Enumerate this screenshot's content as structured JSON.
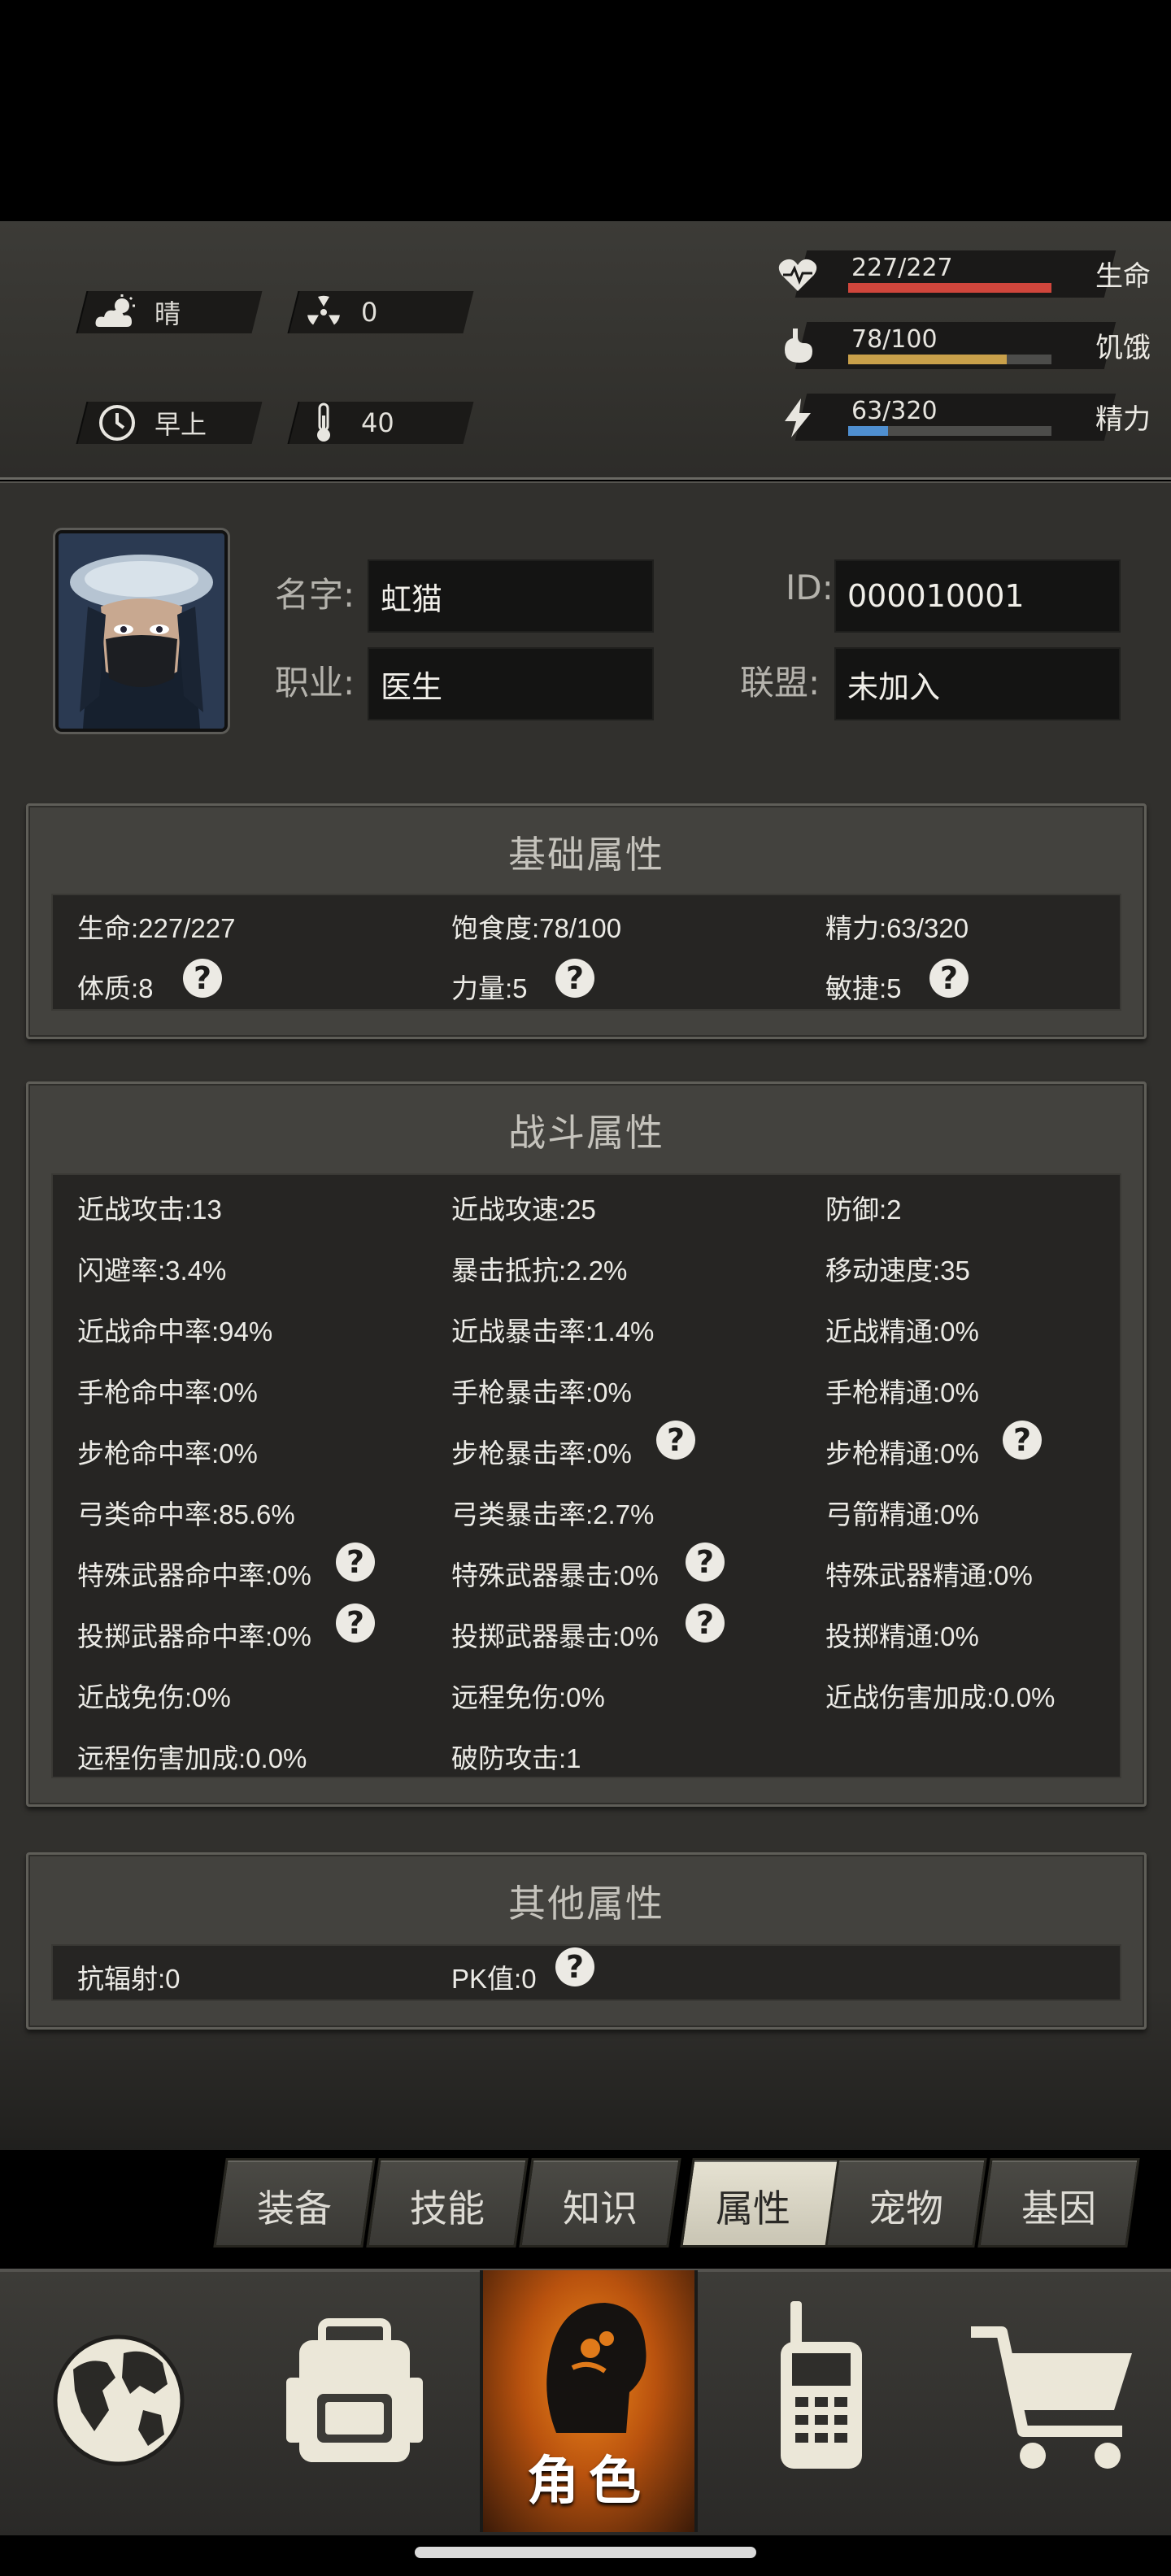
{
  "status": {
    "weather": "晴",
    "radiation": "0",
    "time_of_day": "早上",
    "temperature": "40",
    "hp": {
      "value": "227/227",
      "label": "生命",
      "fraction": 1.0,
      "color": "#d0463c"
    },
    "hunger": {
      "value": "78/100",
      "label": "饥饿",
      "fraction": 0.78,
      "color": "#c9a04a"
    },
    "energy": {
      "value": "63/320",
      "label": "精力",
      "fraction": 0.197,
      "color": "#4f8fd0"
    }
  },
  "profile": {
    "name_label": "名字:",
    "name": "虹猫",
    "job_label": "职业:",
    "job": "医生",
    "id_label": "ID:",
    "id": "000010001",
    "alliance_label": "联盟:",
    "alliance": "未加入"
  },
  "basic": {
    "title": "基础属性",
    "stats": [
      "生命:227/227",
      "饱食度:78/100",
      "精力:63/320",
      "体质:8",
      "力量:5",
      "敏捷:5"
    ]
  },
  "combat": {
    "title": "战斗属性",
    "stats": [
      "近战攻击:13",
      "近战攻速:25",
      "防御:2",
      "闪避率:3.4%",
      "暴击抵抗:2.2%",
      "移动速度:35",
      "近战命中率:94%",
      "近战暴击率:1.4%",
      "近战精通:0%",
      "手枪命中率:0%",
      "手枪暴击率:0%",
      "手枪精通:0%",
      "步枪命中率:0%",
      "步枪暴击率:0%",
      "步枪精通:0%",
      "弓类命中率:85.6%",
      "弓类暴击率:2.7%",
      "弓箭精通:0%",
      "特殊武器命中率:0%",
      "特殊武器暴击:0%",
      "特殊武器精通:0%",
      "投掷武器命中率:0%",
      "投掷武器暴击:0%",
      "投掷精通:0%",
      "近战免伤:0%",
      "远程免伤:0%",
      "近战伤害加成:0.0%",
      "远程伤害加成:0.0%",
      "破防攻击:1"
    ]
  },
  "other": {
    "title": "其他属性",
    "stats": [
      "抗辐射:0",
      "PK值:0"
    ]
  },
  "help_icon": "?",
  "tabs": [
    "装备",
    "技能",
    "知识",
    "属性",
    "宠物",
    "基因"
  ],
  "active_tab": "属性",
  "nav": {
    "items": [
      "world-globe-icon",
      "backpack-icon",
      "character-icon",
      "walkie-talkie-icon",
      "shop-cart-icon"
    ],
    "role_label": "角色"
  }
}
